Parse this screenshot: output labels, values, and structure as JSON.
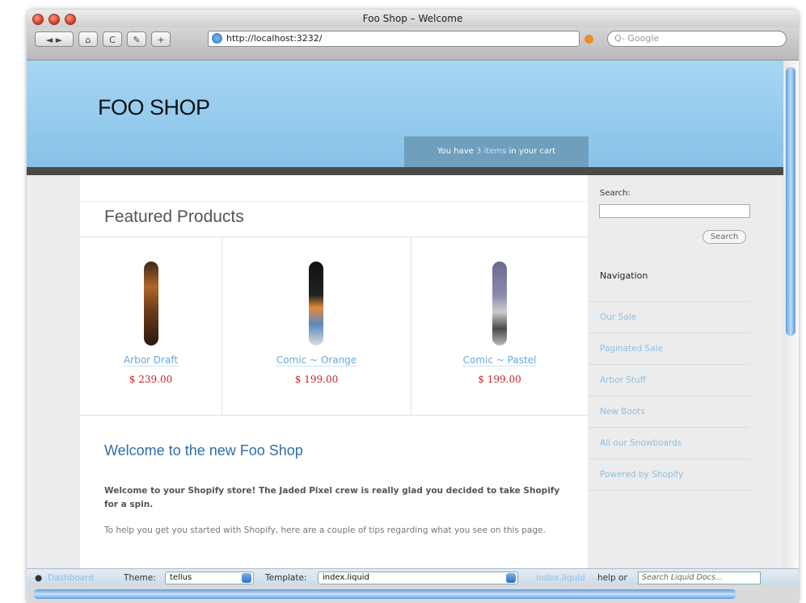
{
  "window": {
    "title": "Foo Shop – Welcome",
    "url": "http://localhost:3232/",
    "search_placeholder": "Q- Google",
    "nav_back_forward": "◄ ►",
    "home_icon": "⌂",
    "reload_icon": "C",
    "edit_icon": "✎",
    "add_icon": "+"
  },
  "header": {
    "logo": "FOO SHOP",
    "cart_prefix": "You have ",
    "cart_link": "3 items",
    "cart_suffix": " in your cart"
  },
  "main": {
    "featured_title": "Featured Products",
    "products": [
      {
        "name": "Arbor Draft",
        "price": "$ 239.00"
      },
      {
        "name": "Comic ~ Orange",
        "price": "$ 199.00"
      },
      {
        "name": "Comic ~ Pastel",
        "price": "$ 199.00"
      }
    ],
    "welcome_title": "Welcome to the new Foo Shop",
    "welcome_bold": "Welcome to your Shopify store! The Jaded Pixel crew is really glad you decided to take Shopify for a spin.",
    "welcome_text": "To help you get you started with Shopify, here are a couple of tips regarding what you see on this page."
  },
  "sidebar": {
    "search_label": "Search:",
    "search_button": "Search",
    "nav_title": "Navigation",
    "nav_items": [
      "Our Sale",
      "Paginated Sale",
      "Arbor Stuff",
      "New Boots",
      "All our Snowboards",
      "Powered by Shopify"
    ]
  },
  "liquid_bar": {
    "dashboard": "Dashboard",
    "theme_label": "Theme:",
    "theme_value": "tellus",
    "template_label": "Template:",
    "template_value": "index.liquid",
    "file_link": "index.liquid",
    "help_text": "help or",
    "docs_placeholder": "Search Liquid Docs..."
  }
}
